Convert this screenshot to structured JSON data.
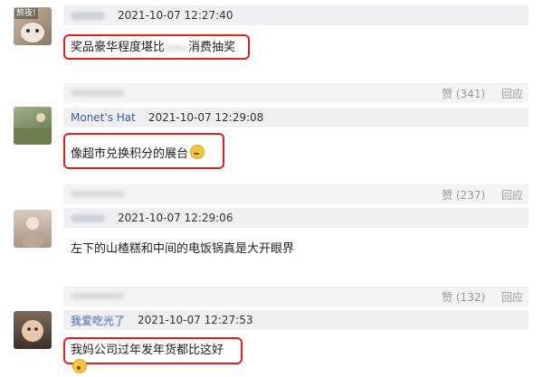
{
  "comments": [
    {
      "avatar_label": "熬夜!",
      "username": "",
      "time": "2021-10-07 12:27:40",
      "text_a": "奖品豪华程度堪比",
      "text_b": "消费抽奖",
      "reply_likes": "赞 (341)",
      "reply_label": "回应"
    },
    {
      "username": "Monet's Hat",
      "time": "2021-10-07 12:29:08",
      "text": "像超市兑换积分的展台",
      "reply_likes": "赞 (237)",
      "reply_label": "回应"
    },
    {
      "username": "",
      "time": "2021-10-07 12:29:06",
      "text": "左下的山楂糕和中间的电饭锅真是大开眼界",
      "reply_likes": "赞 (132)",
      "reply_label": "回应"
    },
    {
      "username": "我爱吃光了",
      "time": "2021-10-07 12:27:53",
      "text": "我妈公司过年发年货都比这好"
    }
  ],
  "colors": {
    "highlight": "#e02020",
    "meta_bg": "#eef0f4",
    "username": "#3b5e9c"
  }
}
